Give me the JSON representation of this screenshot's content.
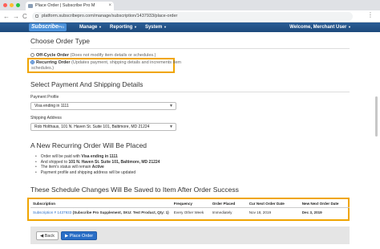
{
  "browser": {
    "tab_title": "Place Order | Subscribe Pro M",
    "tab_close": "×",
    "url": "platform.subscribepro.com/manage/subscription/1437933/place-order",
    "back": "←",
    "forward": "→",
    "reload": "C",
    "menu": "⋮"
  },
  "appnav": {
    "logo": "Subscribe",
    "logo_pro": "Pro",
    "menu": [
      {
        "label": "Manage"
      },
      {
        "label": "Reporting"
      },
      {
        "label": "System"
      }
    ],
    "caret": "▼",
    "welcome": "Welcome, Merchant User",
    "welcome_caret": "▼"
  },
  "order_type": {
    "heading": "Choose Order Type",
    "off_cycle_label": "Off-Cycle Order",
    "off_cycle_note": "(Does not modify item details or schedules.)",
    "recurring_label": "Recurring Order",
    "recurring_note_line1": "(Updates payment, shipping details and increments item",
    "recurring_note_line2": "schedules.)",
    "selected": "recurring"
  },
  "payment_shipping": {
    "heading": "Select Payment And Shipping Details",
    "payment_label": "Payment Profile",
    "payment_value": "Visa ending in 1111",
    "shipping_label": "Shipping Address",
    "shipping_value": "Rob Holthaus, 101 N. Haven St. Suite 101, Baltimore, MD 21224"
  },
  "summary": {
    "heading": "A New Recurring Order Will Be Placed",
    "bullets": [
      {
        "pre": "Order will be paid with ",
        "bold": "Visa ending in 1111"
      },
      {
        "pre": "And shipped to ",
        "bold": "101 N. Haven St. Suite 101, Baltimore, MD 21224"
      },
      {
        "pre": "The item's status will remain ",
        "bold": "Active"
      },
      {
        "pre": "Payment profile and shipping address will be updated",
        "bold": ""
      }
    ]
  },
  "schedule": {
    "heading": "These Schedule Changes Will Be Saved to Item After Order Success",
    "columns": [
      "Subscription",
      "Frequency",
      "Order Placed",
      "Cur Next Order Date",
      "New Next Order Date"
    ],
    "rows": [
      {
        "subscription_link": "Subscription # 1437933",
        "subscription_text": "(Subscribe Pro Supplement, SKU: Test Product, Qty: 1)",
        "frequency": "Every Other Week",
        "order_placed": "Immediately",
        "cur_next": "Nov 18, 2019",
        "new_next": "Dec 3, 2019"
      }
    ]
  },
  "actions": {
    "back": "◀ Back",
    "place_order": "▶ Place Order"
  },
  "colors": {
    "nav": "#1e4a7c",
    "highlight": "#f0a500",
    "primary": "#2a6ec6"
  }
}
